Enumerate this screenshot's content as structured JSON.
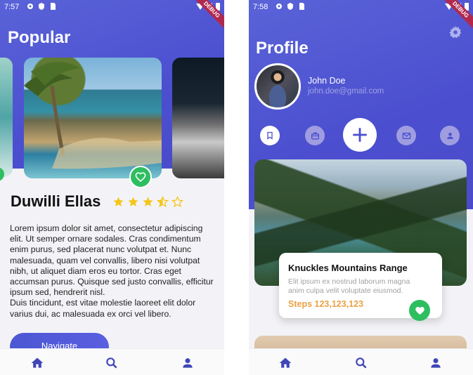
{
  "colors": {
    "primary": "#4b4fcf",
    "heart_green": "#2dbe60",
    "star": "#f5c518",
    "steps_orange": "#e9a246"
  },
  "popular_screen": {
    "status_time": "7:57",
    "debug_label": "DEBUG",
    "heading": "Popular",
    "place_title": "Duwilli Ellas",
    "rating": 3.5,
    "rating_max": 5,
    "description": "Lorem ipsum dolor sit amet, consectetur adipiscing elit. Ut semper ornare sodales. Cras condimentum enim purus, sed placerat nunc volutpat et. Nunc malesuada, quam vel convallis, libero nisi volutpat nibh, ut aliquet diam eros eu tortor. Cras eget accumsan purus. Quisque sed justo convallis, efficitur ipsum sed, hendrerit nisl.\nDuis tincidunt, est vitae molestie laoreet elit dolor varius dui, ac malesuada ex orci vel libero.",
    "navigate_label": "Navigate",
    "bottom_nav": [
      "home-icon",
      "search-icon",
      "person-icon"
    ]
  },
  "profile_screen": {
    "status_time": "7:58",
    "debug_label": "DEBUG",
    "heading": "Profile",
    "user_name": "John Doe",
    "user_email": "john.doe@gmail.com",
    "actions": [
      "bookmark-icon",
      "bag-icon",
      "plus-icon",
      "mail-icon",
      "person-icon"
    ],
    "card": {
      "title": "Knuckles Mountains Range",
      "text": "Elit ipsum ex nostrud laborum magna anim culpa velit voluptate eiusmod.",
      "steps": "Steps 123,123,123"
    },
    "bottom_nav": [
      "home-icon",
      "search-icon",
      "person-icon"
    ]
  }
}
